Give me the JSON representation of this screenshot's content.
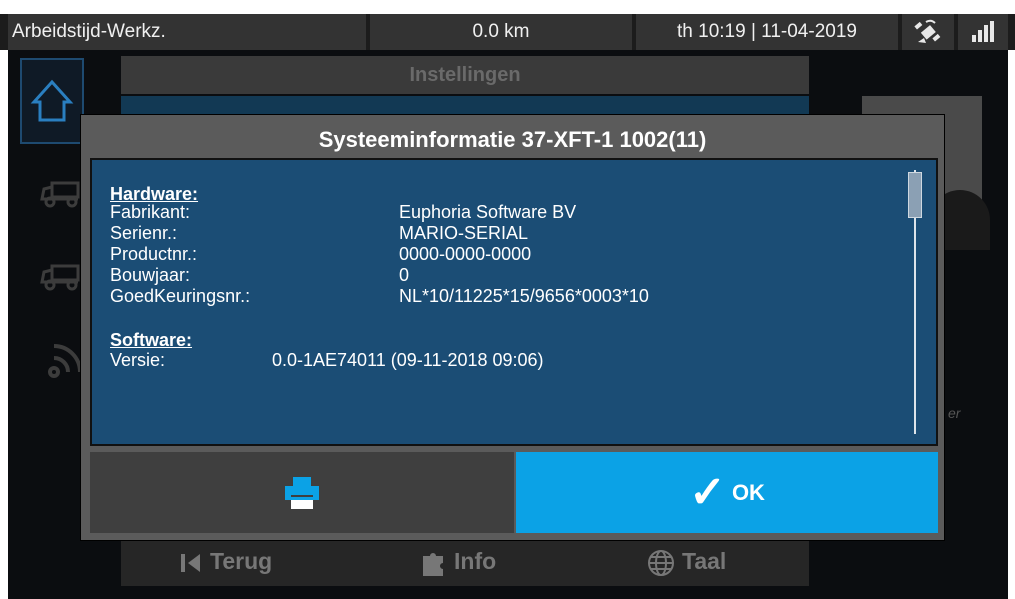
{
  "status_bar": {
    "activity": "Arbeidstijd-Werkz.",
    "distance": "0.0 km",
    "datetime": "th 10:19 | 11-04-2019",
    "gps_icon": "gps-satellite-icon",
    "signal_icon": "signal-strength-icon"
  },
  "background": {
    "header_title": "Instellingen",
    "side_icons": [
      "home-icon",
      "truck-icon",
      "truck-icon",
      "wireless-icon"
    ],
    "bottom_nav": [
      {
        "label": "Terug",
        "icon": "back-icon"
      },
      {
        "label": "Info",
        "icon": "info-puzzle-icon"
      },
      {
        "label": "Taal",
        "icon": "globe-icon"
      }
    ]
  },
  "dialog": {
    "title": "Systeeminformatie  37-XFT-1 1002(11)",
    "hardware": {
      "heading": "Hardware:",
      "rows": [
        {
          "label": "Fabrikant:",
          "value": "Euphoria Software BV"
        },
        {
          "label": "Serienr.:",
          "value": "MARIO-SERIAL"
        },
        {
          "label": "Productnr.:",
          "value": "0000-0000-0000"
        },
        {
          "label": "Bouwjaar:",
          "value": "0"
        },
        {
          "label": "GoedKeuringsnr.:",
          "value": "NL*10/11225*15/9656*0003*10"
        }
      ]
    },
    "software": {
      "heading": "Software:",
      "rows": [
        {
          "label": "Versie:",
          "value": "0.0-1AE74011 (09-11-2018 09:06)"
        }
      ]
    },
    "print_button": {
      "icon": "printer-icon"
    },
    "ok_button": {
      "icon": "checkmark-icon",
      "label": "OK"
    }
  },
  "colors": {
    "accent": "#0ba2e6",
    "content_bg": "#1b4d75",
    "dialog_bg": "#5b5b5b"
  }
}
